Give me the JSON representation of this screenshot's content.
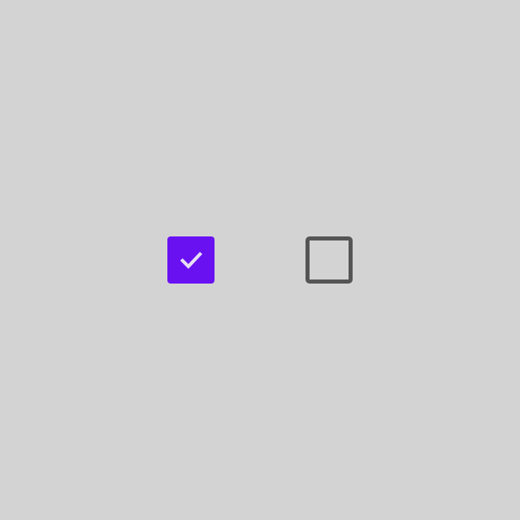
{
  "checkboxes": [
    {
      "name": "checkbox-checked",
      "checked": true,
      "icon": "checkmark-icon",
      "fill_color": "#6a11f2",
      "check_color": "#e6e0f2"
    },
    {
      "name": "checkbox-unchecked",
      "checked": false,
      "border_color": "#555555"
    }
  ],
  "colors": {
    "background": "#d3d3d3",
    "accent": "#6a11f2",
    "unchecked_border": "#555555"
  }
}
